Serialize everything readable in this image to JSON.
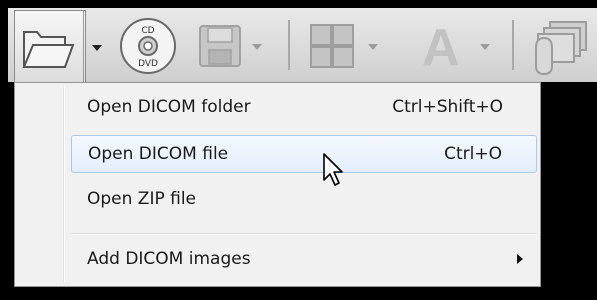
{
  "toolbar": {
    "buttons": [
      {
        "name": "open-folder",
        "icon": "folder-open-icon",
        "state": "pressed"
      },
      {
        "name": "burn-cd-dvd",
        "icon": "cd-dvd-icon",
        "cd_text": "CD",
        "dvd_text": "DVD"
      },
      {
        "name": "save",
        "icon": "floppy-disk-icon",
        "state": "disabled"
      },
      {
        "name": "layout",
        "icon": "grid-layout-icon",
        "state": "disabled"
      },
      {
        "name": "annotation",
        "icon": "letter-a-icon",
        "letter": "A",
        "state": "disabled"
      },
      {
        "name": "series",
        "icon": "image-stack-icon",
        "state": "disabled"
      }
    ]
  },
  "menu": {
    "items": [
      {
        "label": "Open DICOM folder",
        "shortcut": "Ctrl+Shift+O"
      },
      {
        "label": "Open DICOM file",
        "shortcut": "Ctrl+O",
        "highlighted": true
      },
      {
        "label": "Open ZIP file",
        "shortcut": ""
      },
      {
        "label": "Add DICOM images",
        "shortcut": "",
        "submenu": true
      }
    ]
  },
  "colors": {
    "background": "#000000",
    "toolbar": "#dcdcdc",
    "menu_background": "#f1f1f1",
    "highlight_border": "#a8c8ec",
    "highlight_fill": "#e3eefb"
  }
}
